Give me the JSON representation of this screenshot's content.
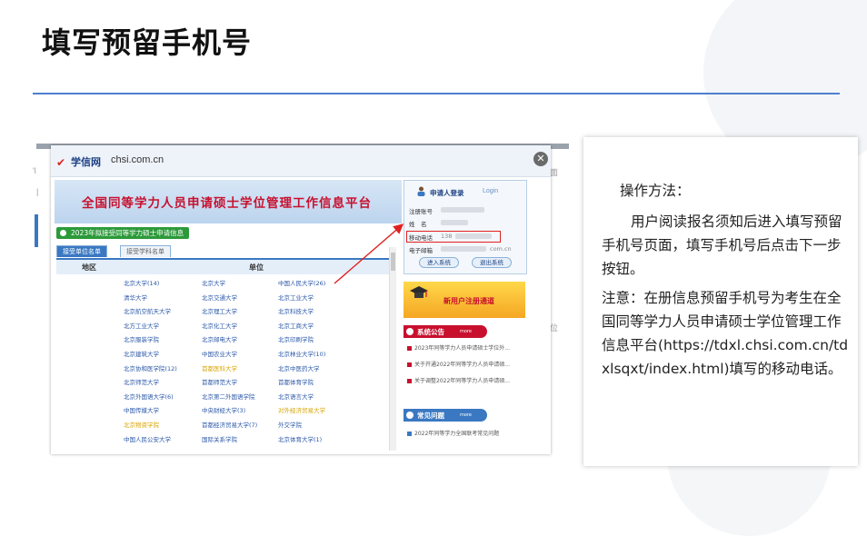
{
  "slide": {
    "title": "填写预留手机号"
  },
  "screenshot": {
    "site_logo": "学信网",
    "site_url": "chsi.com.cn",
    "bg_fragments": [
      "'l",
      "|",
      "上面",
      "面位"
    ],
    "close_icon": "close-icon",
    "system_title": "全国同等学力人员申请硕士学位管理工作信息平台",
    "green_tag": "2023年拟接受同等学力硕士申请信息",
    "tabs": [
      "接受单位名单",
      "接受学科名单"
    ],
    "table_headers": {
      "region": "地区",
      "unit": "单位"
    },
    "units": [
      [
        "北京大学(14)",
        "北京大学",
        "中国人民大学(26)"
      ],
      [
        "清华大学",
        "北京交通大学",
        "北京工业大学"
      ],
      [
        "北京航空航天大学",
        "北京理工大学",
        "北京科技大学"
      ],
      [
        "北方工业大学",
        "北京化工大学",
        "北京工商大学"
      ],
      [
        "北京服装学院",
        "北京邮电大学",
        "北京印刷学院"
      ],
      [
        "北京建筑大学",
        "中国农业大学",
        "北京林业大学(10)"
      ],
      [
        "北京协和医学院(12)",
        "首都医科大学",
        "北京中医药大学"
      ],
      [
        "北京师范大学",
        "首都师范大学",
        "首都体育学院"
      ],
      [
        "北京外国语大学(6)",
        "北京第二外国语学院",
        "北京语言大学"
      ],
      [
        "中国传媒大学",
        "中央财经大学(3)",
        "对外经济贸易大学"
      ],
      [
        "北京物资学院",
        "首都经济贸易大学(7)",
        "外交学院"
      ],
      [
        "中国人民公安大学",
        "国际关系学院",
        "北京体育大学(1)"
      ]
    ],
    "login": {
      "title": "申请人登录",
      "title_en": "Login",
      "fields": [
        "注册账号",
        "姓　名",
        "移动电话",
        "电子邮箱"
      ],
      "phone_value": "138",
      "email_value": "com.cn",
      "buttons": [
        "进入系统",
        "退出系统"
      ]
    },
    "register_banner": "新用户注册通道",
    "announcements": {
      "title": "系统公告",
      "more": "more",
      "items": [
        "2023年同等学力人员申请硕士学位外...",
        "关于开通2022年同等学力人员申请硕...",
        "关于调整2022年同等学力人员申请硕..."
      ]
    },
    "faq": {
      "title": "常见问题",
      "more": "more",
      "items": [
        "2022年同等学力全国联考常见问题"
      ]
    },
    "colors": {
      "highlight": "#e02020",
      "brand": "#1c3f82",
      "title_red": "#c8102e"
    }
  },
  "note": {
    "heading": "操作方法：",
    "paragraph1": "用户阅读报名须知后进入填写预留手机号页面，填写手机号后点击下一步按钮。",
    "paragraph2": "注意：在册信息预留手机号为考生在全国同等学力人员申请硕士学位管理工作信息平台(https://tdxl.chsi.com.cn/tdxlsqxt/index.html)填写的移动电话。"
  }
}
